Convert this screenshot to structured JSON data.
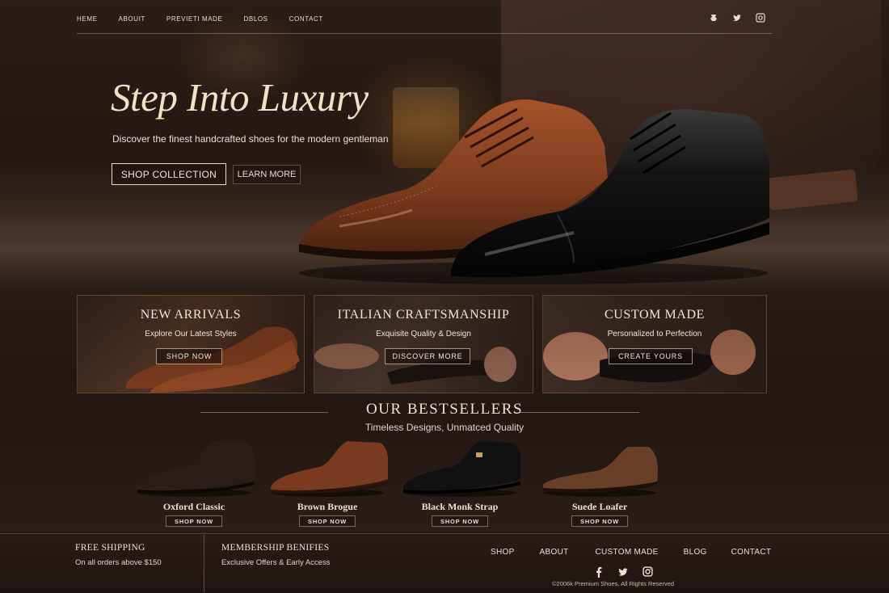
{
  "nav": {
    "items": [
      "HEME",
      "ABOUIT",
      "PREVIETI MADE",
      "DBLOS",
      "CONTACT"
    ],
    "social_icons": [
      "brand-icon",
      "twitter-icon",
      "instagram-icon"
    ]
  },
  "hero": {
    "title": "Step Into Luxury",
    "subtitle": "Discover the finest handcrafted shoes for the modern gentleman",
    "primary_button": "SHOP COLLECTION",
    "secondary_button": "LEARN MORE"
  },
  "categories": [
    {
      "title": "NEW ARRIVALS",
      "subtitle": "Explore Our Latest Styles",
      "button": "SHOP NOW"
    },
    {
      "title": "ITALIAN CRAFTSMANSHIP",
      "subtitle": "Exquisite Quality & Design",
      "button": "DISCOVER MORE"
    },
    {
      "title": "CUSTOM MADE",
      "subtitle": "Personalized to Perfection",
      "button": "CREATE YOURS"
    }
  ],
  "bestsellers": {
    "title": "OUR BESTSELLERS",
    "subtitle": "Timeless Designs, Unmatced Quality",
    "products": [
      {
        "name": "Oxford Classic",
        "button": "SHOP NOW",
        "color": "#2a1d1a"
      },
      {
        "name": "Brown Brogue",
        "button": "SHOP NOW",
        "color": "#7a3a1f"
      },
      {
        "name": "Black Monk Strap",
        "button": "SHOP NOW",
        "color": "#111111"
      },
      {
        "name": "Suede Loafer",
        "button": "SHOP NOW",
        "color": "#6a3f28"
      }
    ]
  },
  "footer": {
    "shipping_title": "FREE SHIPPING",
    "shipping_text": "On all orders above $150",
    "membership_title": "MEMBERSHIP BENIFIES",
    "membership_text": "Exclusive Offers & Early Access",
    "nav": [
      "SHOP",
      "ABOUT",
      "CUSTOM MADE",
      "BLOG",
      "CONTACT"
    ],
    "social_icons": [
      "facebook-icon",
      "twitter-icon",
      "instagram-icon"
    ],
    "copyright": "©2006k Premium Shoes, All Rights Reserved"
  },
  "colors": {
    "background": "#1f1512",
    "text": "#efe3d3",
    "accent": "#f2e1c6"
  }
}
